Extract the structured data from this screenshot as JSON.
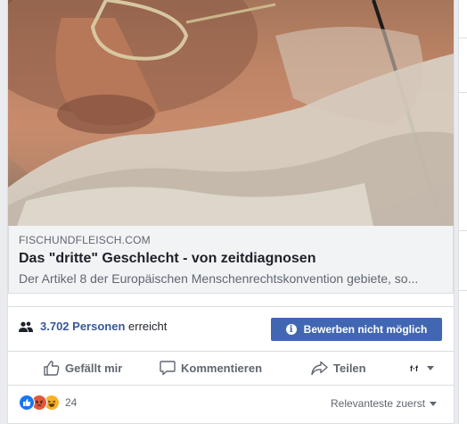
{
  "link_preview": {
    "domain": "FISCHUNDFLEISCH.COM",
    "title": "Das \"dritte\" Geschlecht - von zeitdiagnosen",
    "description": "Der Artikel 8 der Europäischen Menschenrechtskonvention gebiete, so..."
  },
  "reach": {
    "count": "3.702 Personen",
    "suffix": "erreicht",
    "icon": "people-icon"
  },
  "boost_button": {
    "label": "Bewerben nicht möglich",
    "icon": "info-icon"
  },
  "actions": {
    "like": "Gefällt mir",
    "comment": "Kommentieren",
    "share": "Teilen"
  },
  "reactions": {
    "types": [
      "like",
      "angry",
      "haha"
    ],
    "count": "24"
  },
  "sort": {
    "label": "Relevanteste zuerst"
  },
  "colors": {
    "accent": "#4267b2",
    "link": "#385898",
    "muted": "#606770"
  }
}
